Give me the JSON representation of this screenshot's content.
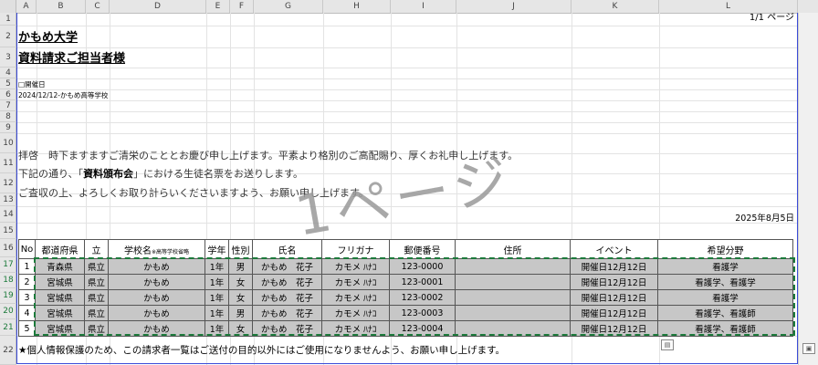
{
  "columns": [
    "A",
    "B",
    "C",
    "D",
    "E",
    "F",
    "G",
    "H",
    "I",
    "J",
    "K",
    "L"
  ],
  "rows": [
    "1",
    "2",
    "3",
    "4",
    "5",
    "6",
    "7",
    "8",
    "9",
    "10",
    "11",
    "12",
    "13",
    "14",
    "15",
    "16",
    "17",
    "18",
    "19",
    "20",
    "21",
    "22"
  ],
  "header": {
    "page_indicator": "1/1 ページ",
    "title1": "かもめ大学",
    "title2": "資料請求ご担当者様",
    "event_label": "□開催日",
    "event_detail": "2024/12/12-かもめ高等学校",
    "greeting": "拝啓　時下ますますご清栄のこととお慶び申し上げます。平素より格別のご高配賜り、厚くお礼申し上げます。",
    "line2_prefix": "下記の通り、「",
    "line2_bold": "資料頒布会",
    "line2_suffix": "」における生徒名票をお送りします。",
    "line3": "ご査収の上、よろしくお取り計らいくださいますよう、お願い申し上げます。",
    "date": "2025年8月5日",
    "watermark": "1ページ"
  },
  "table": {
    "headers": {
      "no": "No",
      "pref": "都道府県",
      "type": "立",
      "school": "学校名",
      "school_note": "※高等学校省略",
      "grade": "学年",
      "gender": "性別",
      "name": "氏名",
      "kana": "フリガナ",
      "zip": "郵便番号",
      "address": "住所",
      "event": "イベント",
      "wish": "希望分野"
    },
    "rows": [
      {
        "no": "1",
        "pref": "青森県",
        "type": "県立",
        "school": "かもめ",
        "grade": "1年",
        "gender": "男",
        "name": "かもめ　花子",
        "kana": "カモメ ﾊﾅｺ",
        "zip": "123-0000",
        "address": "",
        "event": "開催日12月12日",
        "wish": "看護学"
      },
      {
        "no": "2",
        "pref": "宮城県",
        "type": "県立",
        "school": "かもめ",
        "grade": "1年",
        "gender": "女",
        "name": "かもめ　花子",
        "kana": "カモメ ﾊﾅｺ",
        "zip": "123-0001",
        "address": "",
        "event": "開催日12月12日",
        "wish": "看護学、看護学"
      },
      {
        "no": "3",
        "pref": "宮城県",
        "type": "県立",
        "school": "かもめ",
        "grade": "1年",
        "gender": "女",
        "name": "かもめ　花子",
        "kana": "カモメ ﾊﾅｺ",
        "zip": "123-0002",
        "address": "",
        "event": "開催日12月12日",
        "wish": "看護学"
      },
      {
        "no": "4",
        "pref": "宮城県",
        "type": "県立",
        "school": "かもめ",
        "grade": "1年",
        "gender": "男",
        "name": "かもめ　花子",
        "kana": "カモメ ﾊﾅｺ",
        "zip": "123-0003",
        "address": "",
        "event": "開催日12月12日",
        "wish": "看護学、看護師"
      },
      {
        "no": "5",
        "pref": "宮城県",
        "type": "県立",
        "school": "かもめ",
        "grade": "1年",
        "gender": "女",
        "name": "かもめ　花子",
        "kana": "カモメ ﾊﾅｺ",
        "zip": "123-0004",
        "address": "",
        "event": "開催日12月12日",
        "wish": "看護学、看護師"
      }
    ]
  },
  "footer_note": "★個人情報保護のため、この請求者一覧はご送付の目的以外にはご使用になりませんよう、お願い申し上げます。"
}
